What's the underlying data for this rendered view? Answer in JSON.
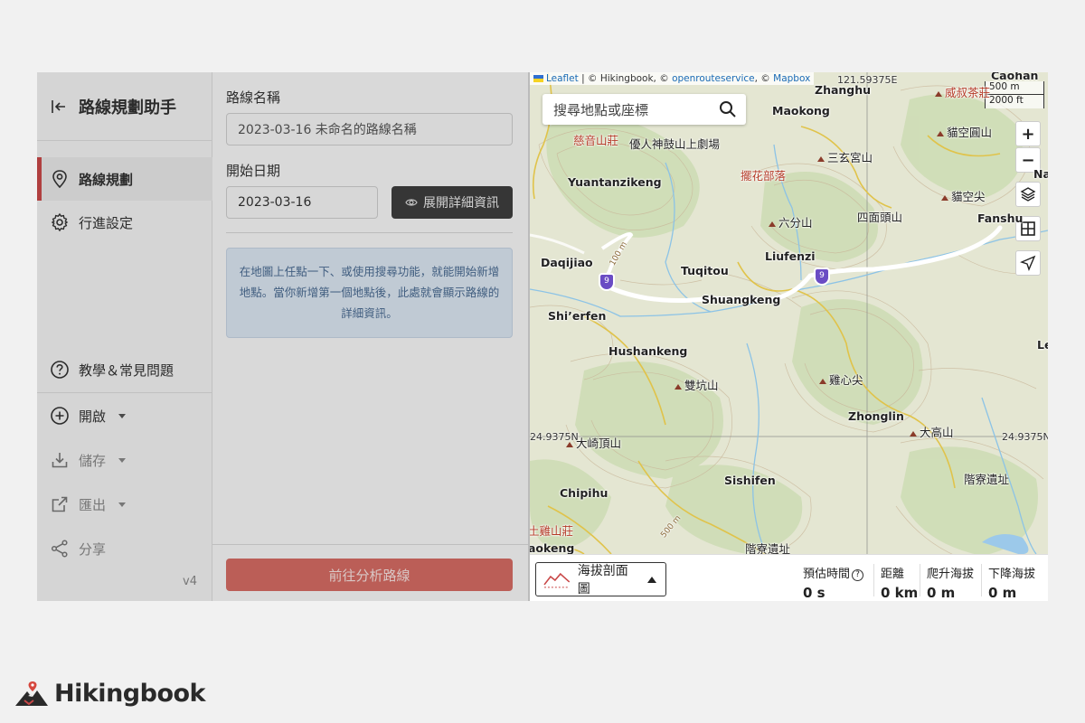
{
  "sidebar": {
    "title": "路線規劃助手",
    "nav": [
      {
        "label": "路線規劃"
      },
      {
        "label": "行進設定"
      }
    ],
    "help": "教學＆常見問題",
    "actions": [
      {
        "label": "開啟"
      },
      {
        "label": "儲存"
      },
      {
        "label": "匯出"
      },
      {
        "label": "分享"
      }
    ],
    "version": "v4"
  },
  "form": {
    "route_name_label": "路線名稱",
    "route_name_placeholder": "2023-03-16 未命名的路線名稱",
    "start_date_label": "開始日期",
    "start_date_value": "2023-03-16",
    "detail_button": "展開詳細資訊",
    "info_text": "在地圖上任點一下、或使用搜尋功能，就能開始新增地點。當你新增第一個地點後，此處就會顯示路線的詳細資訊。",
    "analyze_button": "前往分析路線"
  },
  "map": {
    "attribution": {
      "leaflet": "Leaflet",
      "sep1": " | © Hikingbook, © ",
      "ors": "openrouteservice",
      "sep2": ", © ",
      "mapbox": "Mapbox"
    },
    "scale": {
      "metric": "500 m",
      "imperial": "2000 ft"
    },
    "search_placeholder": "搜尋地點或座標",
    "zoom_in": "+",
    "zoom_out": "−",
    "coords": {
      "lon": "121.59375E",
      "lat_left": "24.9375N",
      "lat_right": "24.9375N"
    },
    "places": [
      {
        "text": "Zhanghu"
      },
      {
        "text": "Maokong"
      },
      {
        "text": "威叔茶莊"
      },
      {
        "text": "Caohan"
      },
      {
        "text": "慈音山莊"
      },
      {
        "text": "優人神鼓山上劇場"
      },
      {
        "text": "貓空圓山"
      },
      {
        "text": "三玄宮山"
      },
      {
        "text": "擺花部落"
      },
      {
        "text": "Yuantanzikeng"
      },
      {
        "text": "貓空尖"
      },
      {
        "text": "四面頭山"
      },
      {
        "text": "六分山"
      },
      {
        "text": "Fanshu"
      },
      {
        "text": "Daqijiao"
      },
      {
        "text": "Tuqitou"
      },
      {
        "text": "Liufenzi"
      },
      {
        "text": "Shuangkeng"
      },
      {
        "text": "Shi’erfen"
      },
      {
        "text": "Hushankeng"
      },
      {
        "text": "雙坑山"
      },
      {
        "text": "雞心尖"
      },
      {
        "text": "Zhonglin"
      },
      {
        "text": "大高山"
      },
      {
        "text": "大崎頂山"
      },
      {
        "text": "Sishifen"
      },
      {
        "text": "階寮遺址"
      },
      {
        "text": "Chipihu"
      },
      {
        "text": "土雞山莊"
      },
      {
        "text": "階寮遺址"
      },
      {
        "text": "aokeng"
      },
      {
        "text": "Na"
      },
      {
        "text": "Le"
      },
      {
        "text": "100 m"
      },
      {
        "text": "500 m"
      }
    ],
    "road_number": "9",
    "profile_button": "海拔剖面圖",
    "stats": [
      {
        "label": "預估時間",
        "value": "0 s"
      },
      {
        "label": "距離",
        "value": "0 km"
      },
      {
        "label": "爬升海拔",
        "value": "0 m"
      },
      {
        "label": "下降海拔",
        "value": "0 m"
      }
    ]
  },
  "brand": {
    "name": "Hikingbook"
  },
  "colors": {
    "accent": "#c94848",
    "route": "#ffffff",
    "info_bg": "#dbe6f2"
  }
}
